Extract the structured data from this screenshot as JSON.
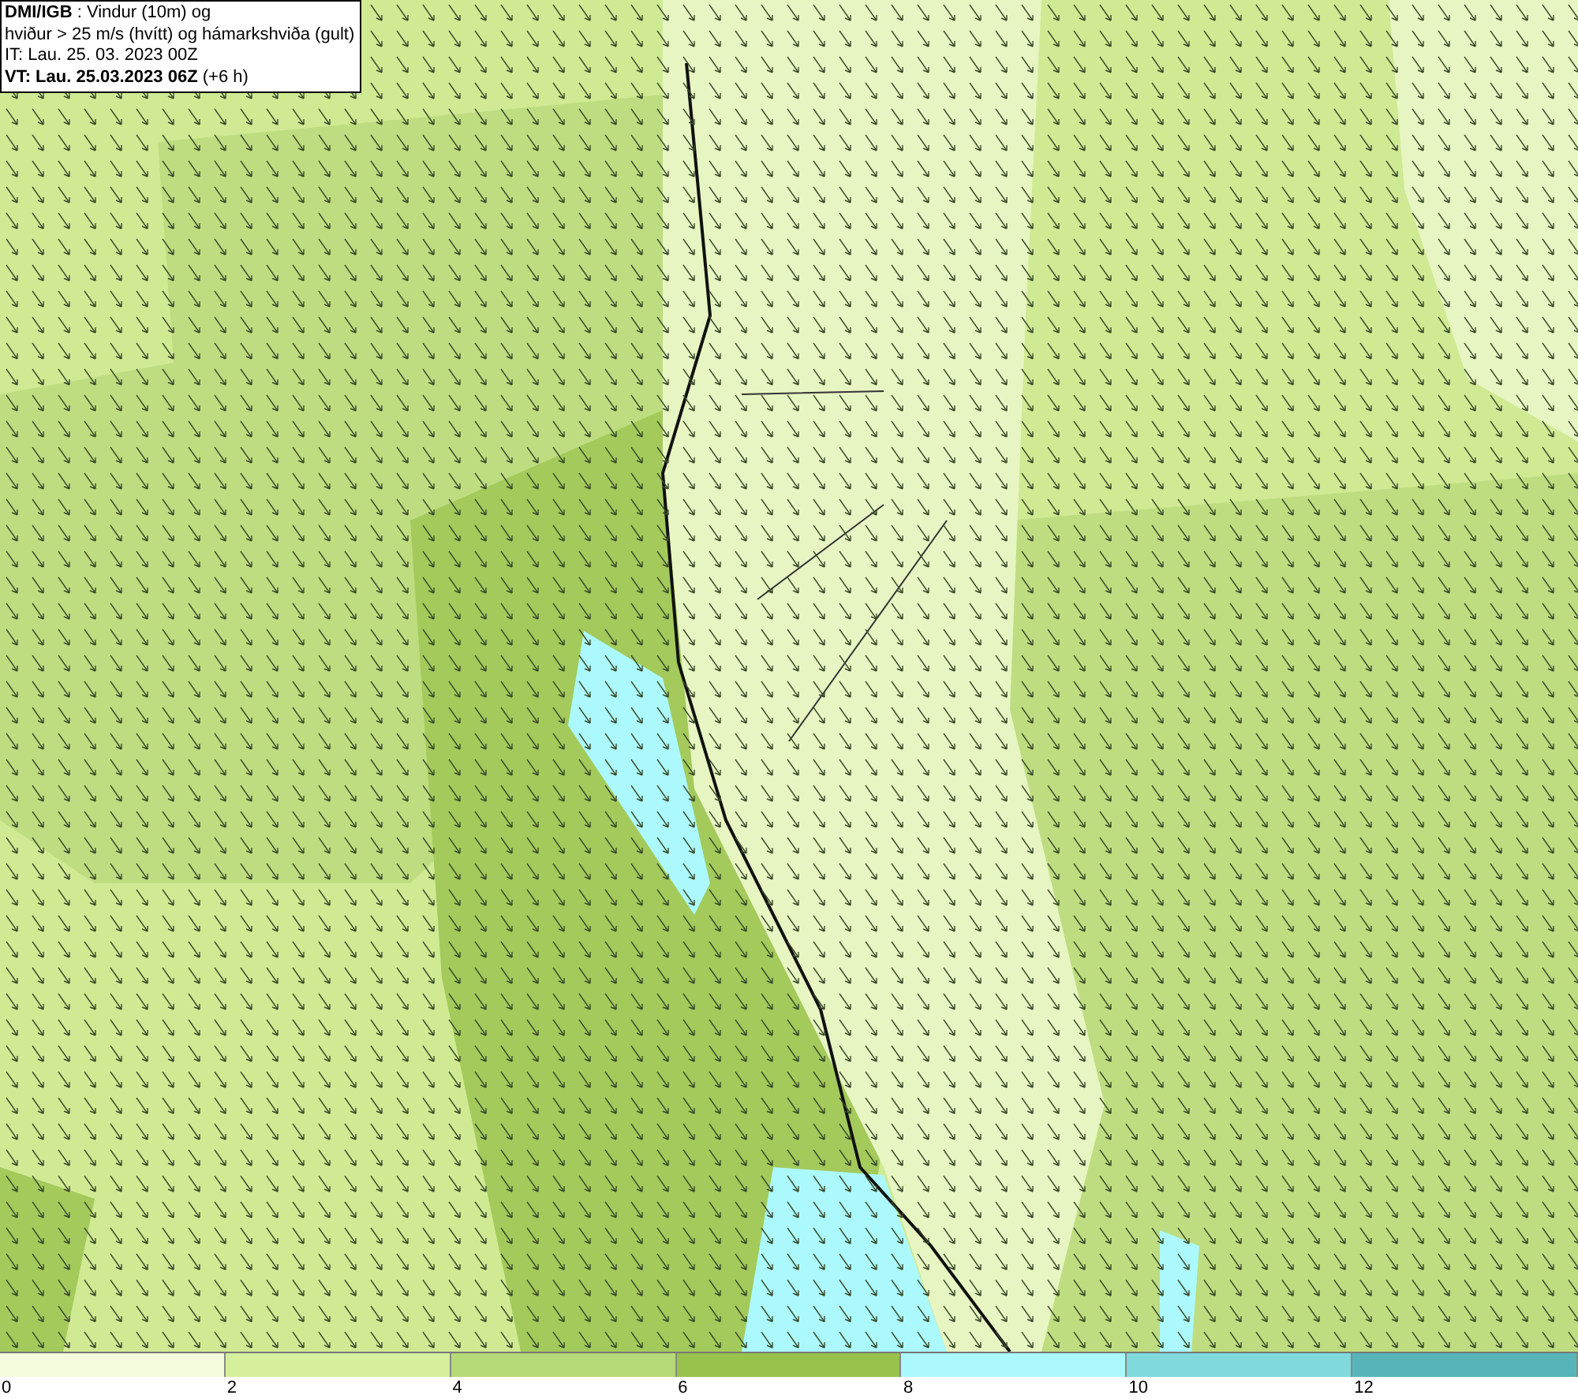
{
  "info_box": {
    "lines": [
      "**DMI/IGB** : Vindur (10m) og",
      "hviður > 25 m/s (hvítt) og hámarkshviða (gult)",
      "IT: Lau. 25. 03. 2023 00Z",
      "**VT: Lau. 25.03.2023 06Z** (+6 h)"
    ]
  },
  "legend": {
    "segments": [
      {
        "color": "#f4fbdd"
      },
      {
        "color": "#d5ef9d"
      },
      {
        "color": "#b6d977"
      },
      {
        "color": "#98c24b"
      },
      {
        "color": "#abf9fc"
      },
      {
        "color": "#80d9dd"
      },
      {
        "color": "#57b5b9"
      }
    ],
    "ticks": [
      "0",
      "2",
      "4",
      "6",
      "8",
      "10",
      "12"
    ]
  }
}
